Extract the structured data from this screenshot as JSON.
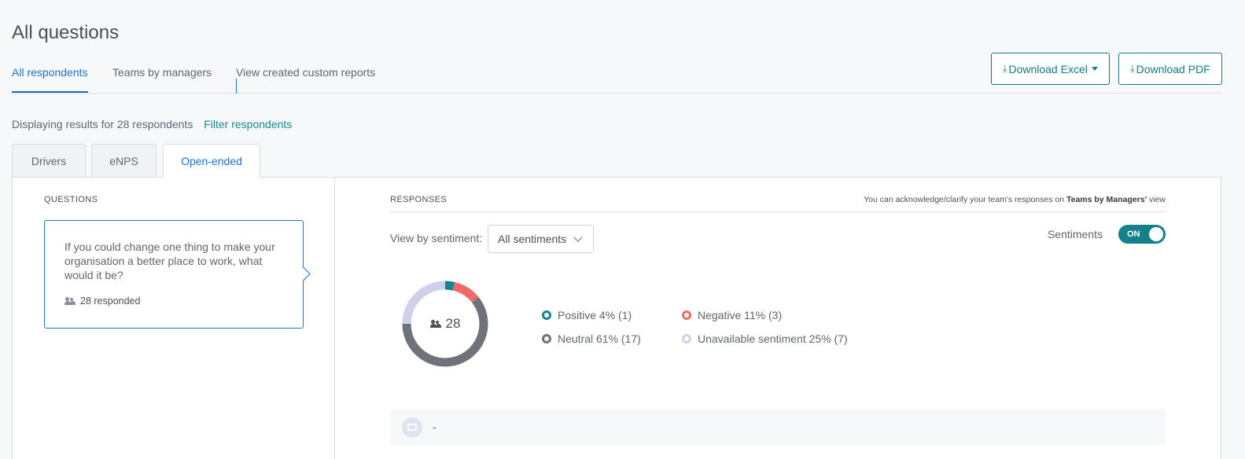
{
  "page": {
    "title": "All questions"
  },
  "top_tabs": [
    {
      "label": "All respondents",
      "active": true
    },
    {
      "label": "Teams by managers",
      "active": false
    },
    {
      "label": "View created custom reports",
      "active": false
    }
  ],
  "actions": {
    "download_excel": "Download Excel",
    "download_pdf": "Download PDF"
  },
  "results": {
    "displaying": "Displaying results for 28 respondents",
    "filter_link": "Filter respondents"
  },
  "sub_tabs": [
    {
      "label": "Drivers",
      "active": false
    },
    {
      "label": "eNPS",
      "active": false
    },
    {
      "label": "Open-ended",
      "active": true
    }
  ],
  "questions_panel": {
    "label": "QUESTIONS",
    "question": {
      "text": "If you could change one thing to make your organisation a better place to work, what would it be?",
      "responded": "28 responded"
    }
  },
  "responses_panel": {
    "label": "RESPONSES",
    "note_prefix": "You can acknowledge/clarify your team's responses on",
    "note_bold": "Teams by Managers'",
    "note_suffix": "view",
    "view_by_label": "View by sentiment:",
    "view_by_value": "All sentiments",
    "sentiments_label": "Sentiments",
    "sentiments_toggle": "ON",
    "sentiments_on": true,
    "total": "28",
    "sentiment_breakdown": [
      {
        "name": "Positive",
        "label": "Positive 4% (1)",
        "count": 1,
        "percent": 4,
        "color": "#12868f"
      },
      {
        "name": "Negative",
        "label": "Negative 11% (3)",
        "count": 3,
        "percent": 11,
        "color": "#f06b66"
      },
      {
        "name": "Neutral",
        "label": "Neutral 61% (17)",
        "count": 17,
        "percent": 61,
        "color": "#6e737a"
      },
      {
        "name": "Unavailable",
        "label": "Unavailable sentiment 25% (7)",
        "count": 7,
        "percent": 25,
        "color": "#cdd2ea"
      }
    ],
    "response_row": {
      "text": "-"
    }
  }
}
